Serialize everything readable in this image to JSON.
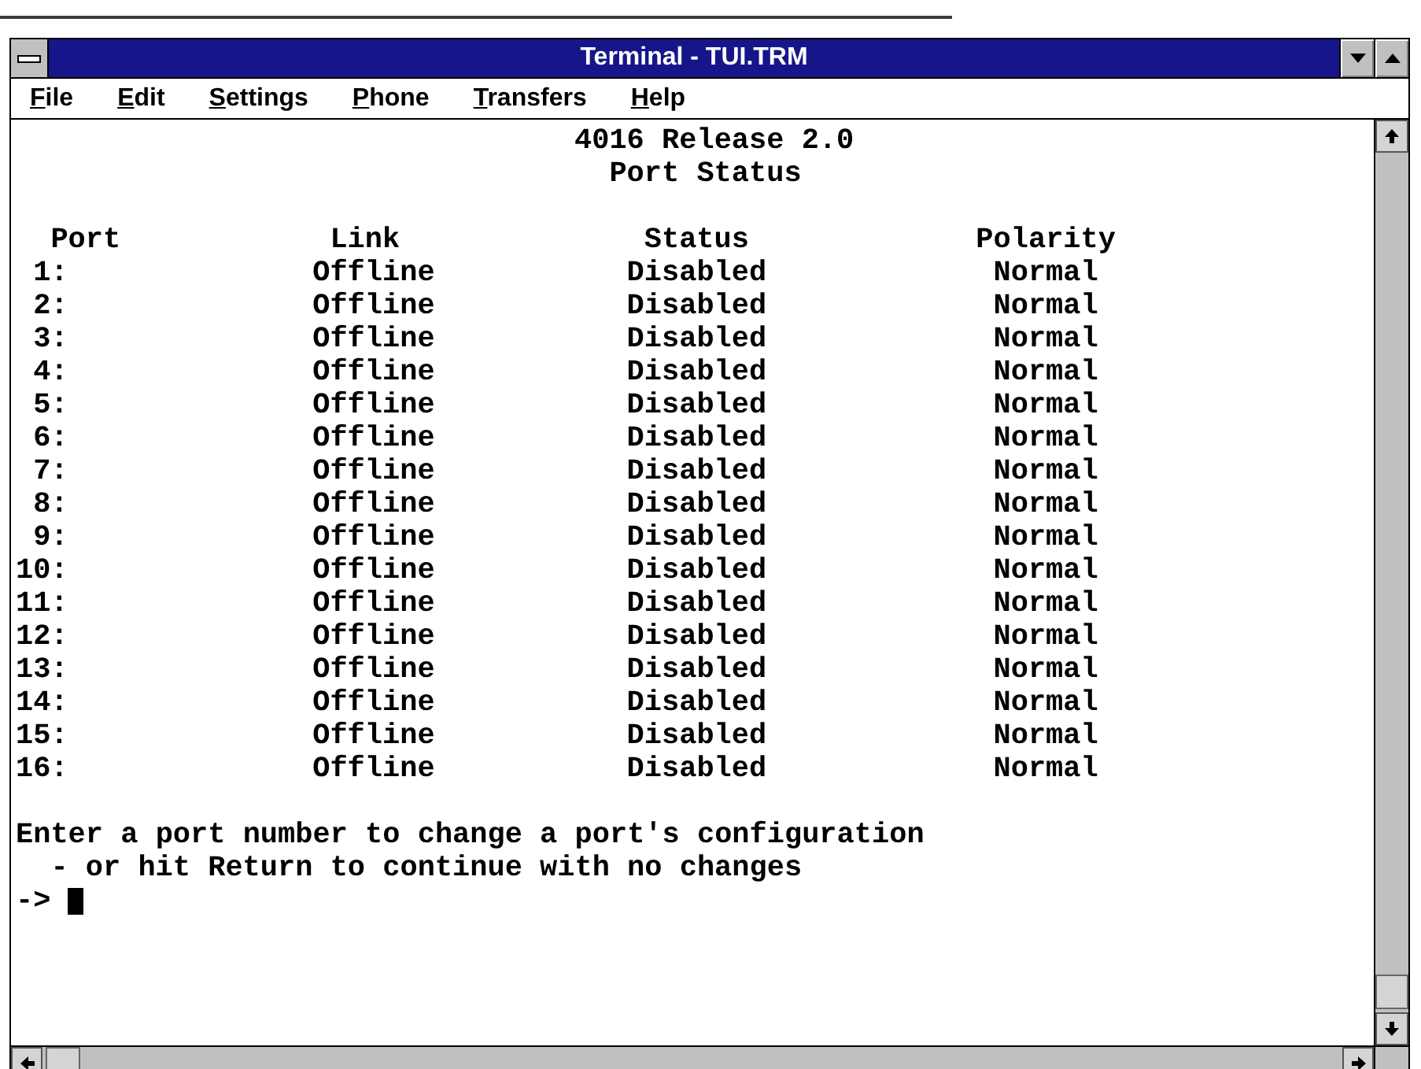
{
  "window": {
    "title": "Terminal - TUI.TRM"
  },
  "menu_bar": [
    "File",
    "Edit",
    "Settings",
    "Phone",
    "Transfers",
    "Help"
  ],
  "terminal": {
    "heading": "4016 Release 2.0",
    "subheading": "Port Status",
    "columns": [
      "Port",
      "Link",
      "Status",
      "Polarity"
    ],
    "rows": [
      {
        "port": "1:",
        "link": "Offline",
        "status": "Disabled",
        "polarity": "Normal"
      },
      {
        "port": "2:",
        "link": "Offline",
        "status": "Disabled",
        "polarity": "Normal"
      },
      {
        "port": "3:",
        "link": "Offline",
        "status": "Disabled",
        "polarity": "Normal"
      },
      {
        "port": "4:",
        "link": "Offline",
        "status": "Disabled",
        "polarity": "Normal"
      },
      {
        "port": "5:",
        "link": "Offline",
        "status": "Disabled",
        "polarity": "Normal"
      },
      {
        "port": "6:",
        "link": "Offline",
        "status": "Disabled",
        "polarity": "Normal"
      },
      {
        "port": "7:",
        "link": "Offline",
        "status": "Disabled",
        "polarity": "Normal"
      },
      {
        "port": "8:",
        "link": "Offline",
        "status": "Disabled",
        "polarity": "Normal"
      },
      {
        "port": "9:",
        "link": "Offline",
        "status": "Disabled",
        "polarity": "Normal"
      },
      {
        "port": "10:",
        "link": "Offline",
        "status": "Disabled",
        "polarity": "Normal"
      },
      {
        "port": "11:",
        "link": "Offline",
        "status": "Disabled",
        "polarity": "Normal"
      },
      {
        "port": "12:",
        "link": "Offline",
        "status": "Disabled",
        "polarity": "Normal"
      },
      {
        "port": "13:",
        "link": "Offline",
        "status": "Disabled",
        "polarity": "Normal"
      },
      {
        "port": "14:",
        "link": "Offline",
        "status": "Disabled",
        "polarity": "Normal"
      },
      {
        "port": "15:",
        "link": "Offline",
        "status": "Disabled",
        "polarity": "Normal"
      },
      {
        "port": "16:",
        "link": "Offline",
        "status": "Disabled",
        "polarity": "Normal"
      }
    ],
    "message_lines": [
      "Enter a port number to change a port's configuration",
      "- or hit Return to continue with no changes"
    ],
    "prompt": "->"
  }
}
